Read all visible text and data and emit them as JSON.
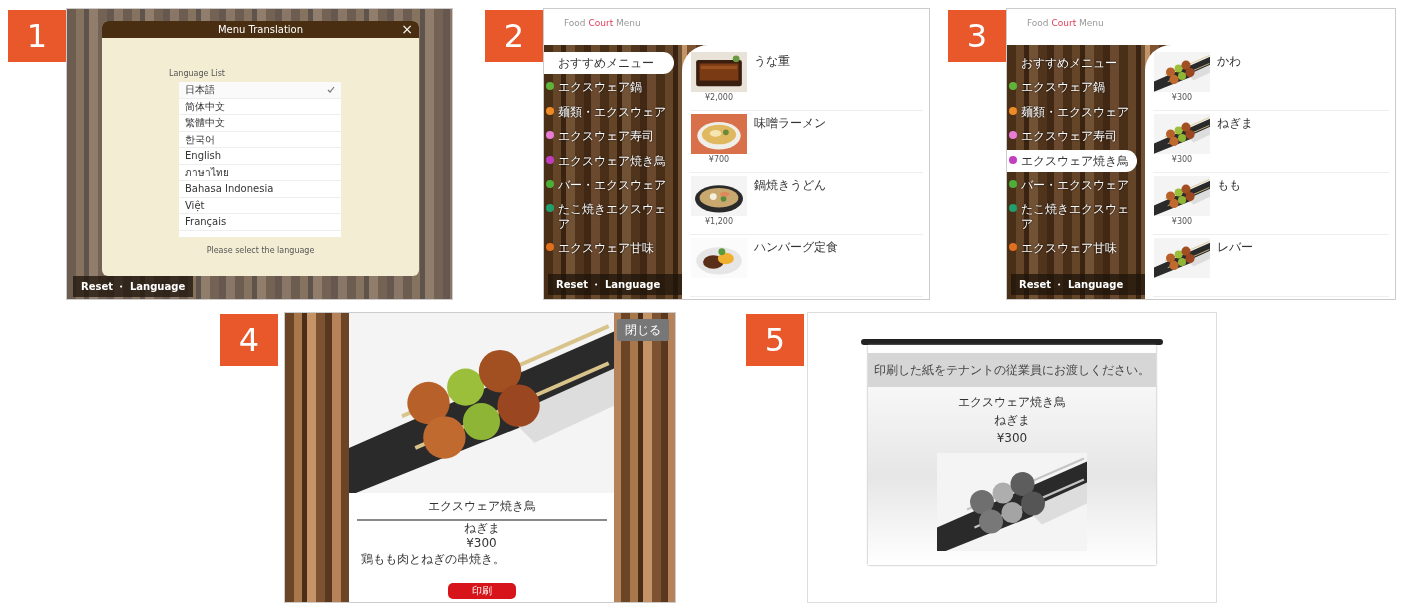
{
  "panels": [
    {
      "number": "1",
      "kind": "language_dialog",
      "dialog": {
        "title": "Menu Translation",
        "close": "×",
        "list_label": "Language List",
        "languages": [
          {
            "label": "日本語",
            "selected": true
          },
          {
            "label": "简体中文",
            "selected": false
          },
          {
            "label": "繁體中文",
            "selected": false
          },
          {
            "label": "한국어",
            "selected": false
          },
          {
            "label": "English",
            "selected": false
          },
          {
            "label": "ภาษาไทย",
            "selected": false
          },
          {
            "label": "Bahasa Indonesia",
            "selected": false
          },
          {
            "label": "Việt",
            "selected": false
          },
          {
            "label": "Français",
            "selected": false
          }
        ],
        "hint": "Please select the language"
      },
      "footer": "Reset ・ Language"
    },
    {
      "number": "2",
      "kind": "menu_list",
      "logo": [
        {
          "text": "Food",
          "accent": false
        },
        {
          "text": "Court",
          "accent": true
        },
        {
          "text": "Menu",
          "accent": false
        }
      ],
      "categories": [
        {
          "label": "おすすめメニュー",
          "selected": true
        },
        {
          "label": "エクスウェア鍋",
          "color": "#5fb33a",
          "selected": false
        },
        {
          "label": "麺類・エクスウェア",
          "color": "#f08a24",
          "selected": false
        },
        {
          "label": "エクスウェア寿司",
          "color": "#e87ad8",
          "selected": false
        },
        {
          "label": "エクスウェア焼き鳥",
          "color": "#c03fc0",
          "selected": false
        },
        {
          "label": "バー・エクスウェア",
          "color": "#4caf3a",
          "selected": false
        },
        {
          "label": "たこ焼きエクスウェア",
          "color": "#1f9e6e",
          "selected": false
        },
        {
          "label": "エクスウェア甘味",
          "color": "#e0701e",
          "selected": false
        }
      ],
      "items": [
        {
          "name": "うな重",
          "price": "¥2,000"
        },
        {
          "name": "味噌ラーメン",
          "price": "¥700"
        },
        {
          "name": "鍋焼きうどん",
          "price": "¥1,200"
        },
        {
          "name": "ハンバーグ定食"
        }
      ],
      "footer": "Reset ・ Language"
    },
    {
      "number": "3",
      "kind": "menu_list",
      "logo": [
        {
          "text": "Food",
          "accent": false
        },
        {
          "text": "Court",
          "accent": true
        },
        {
          "text": "Menu",
          "accent": false
        }
      ],
      "categories": [
        {
          "label": "おすすめメニュー",
          "selected": false
        },
        {
          "label": "エクスウェア鍋",
          "color": "#5fb33a",
          "selected": false
        },
        {
          "label": "麺類・エクスウェア",
          "color": "#f08a24",
          "selected": false
        },
        {
          "label": "エクスウェア寿司",
          "color": "#e87ad8",
          "selected": false
        },
        {
          "label": "エクスウェア焼き鳥",
          "color": "#c03fc0",
          "selected": true
        },
        {
          "label": "バー・エクスウェア",
          "color": "#4caf3a",
          "selected": false
        },
        {
          "label": "たこ焼きエクスウェア",
          "color": "#1f9e6e",
          "selected": false
        },
        {
          "label": "エクスウェア甘味",
          "color": "#e0701e",
          "selected": false
        }
      ],
      "items": [
        {
          "name": "かわ",
          "price": "¥300"
        },
        {
          "name": "ねぎま",
          "price": "¥300"
        },
        {
          "name": "もも",
          "price": "¥300"
        },
        {
          "name": "レバー"
        }
      ],
      "footer": "Reset ・ Language"
    },
    {
      "number": "4",
      "kind": "item_detail",
      "close": "閉じる",
      "category": "エクスウェア焼き鳥",
      "name": "ねぎま",
      "price": "¥300",
      "description": "鶏もも肉とねぎの串焼き。",
      "button": "印刷"
    },
    {
      "number": "5",
      "kind": "print_preview",
      "notice": "印刷した紙をテナントの従業員にお渡しください。",
      "category": "エクスウェア焼き鳥",
      "name": "ねぎま",
      "price": "¥300"
    }
  ]
}
